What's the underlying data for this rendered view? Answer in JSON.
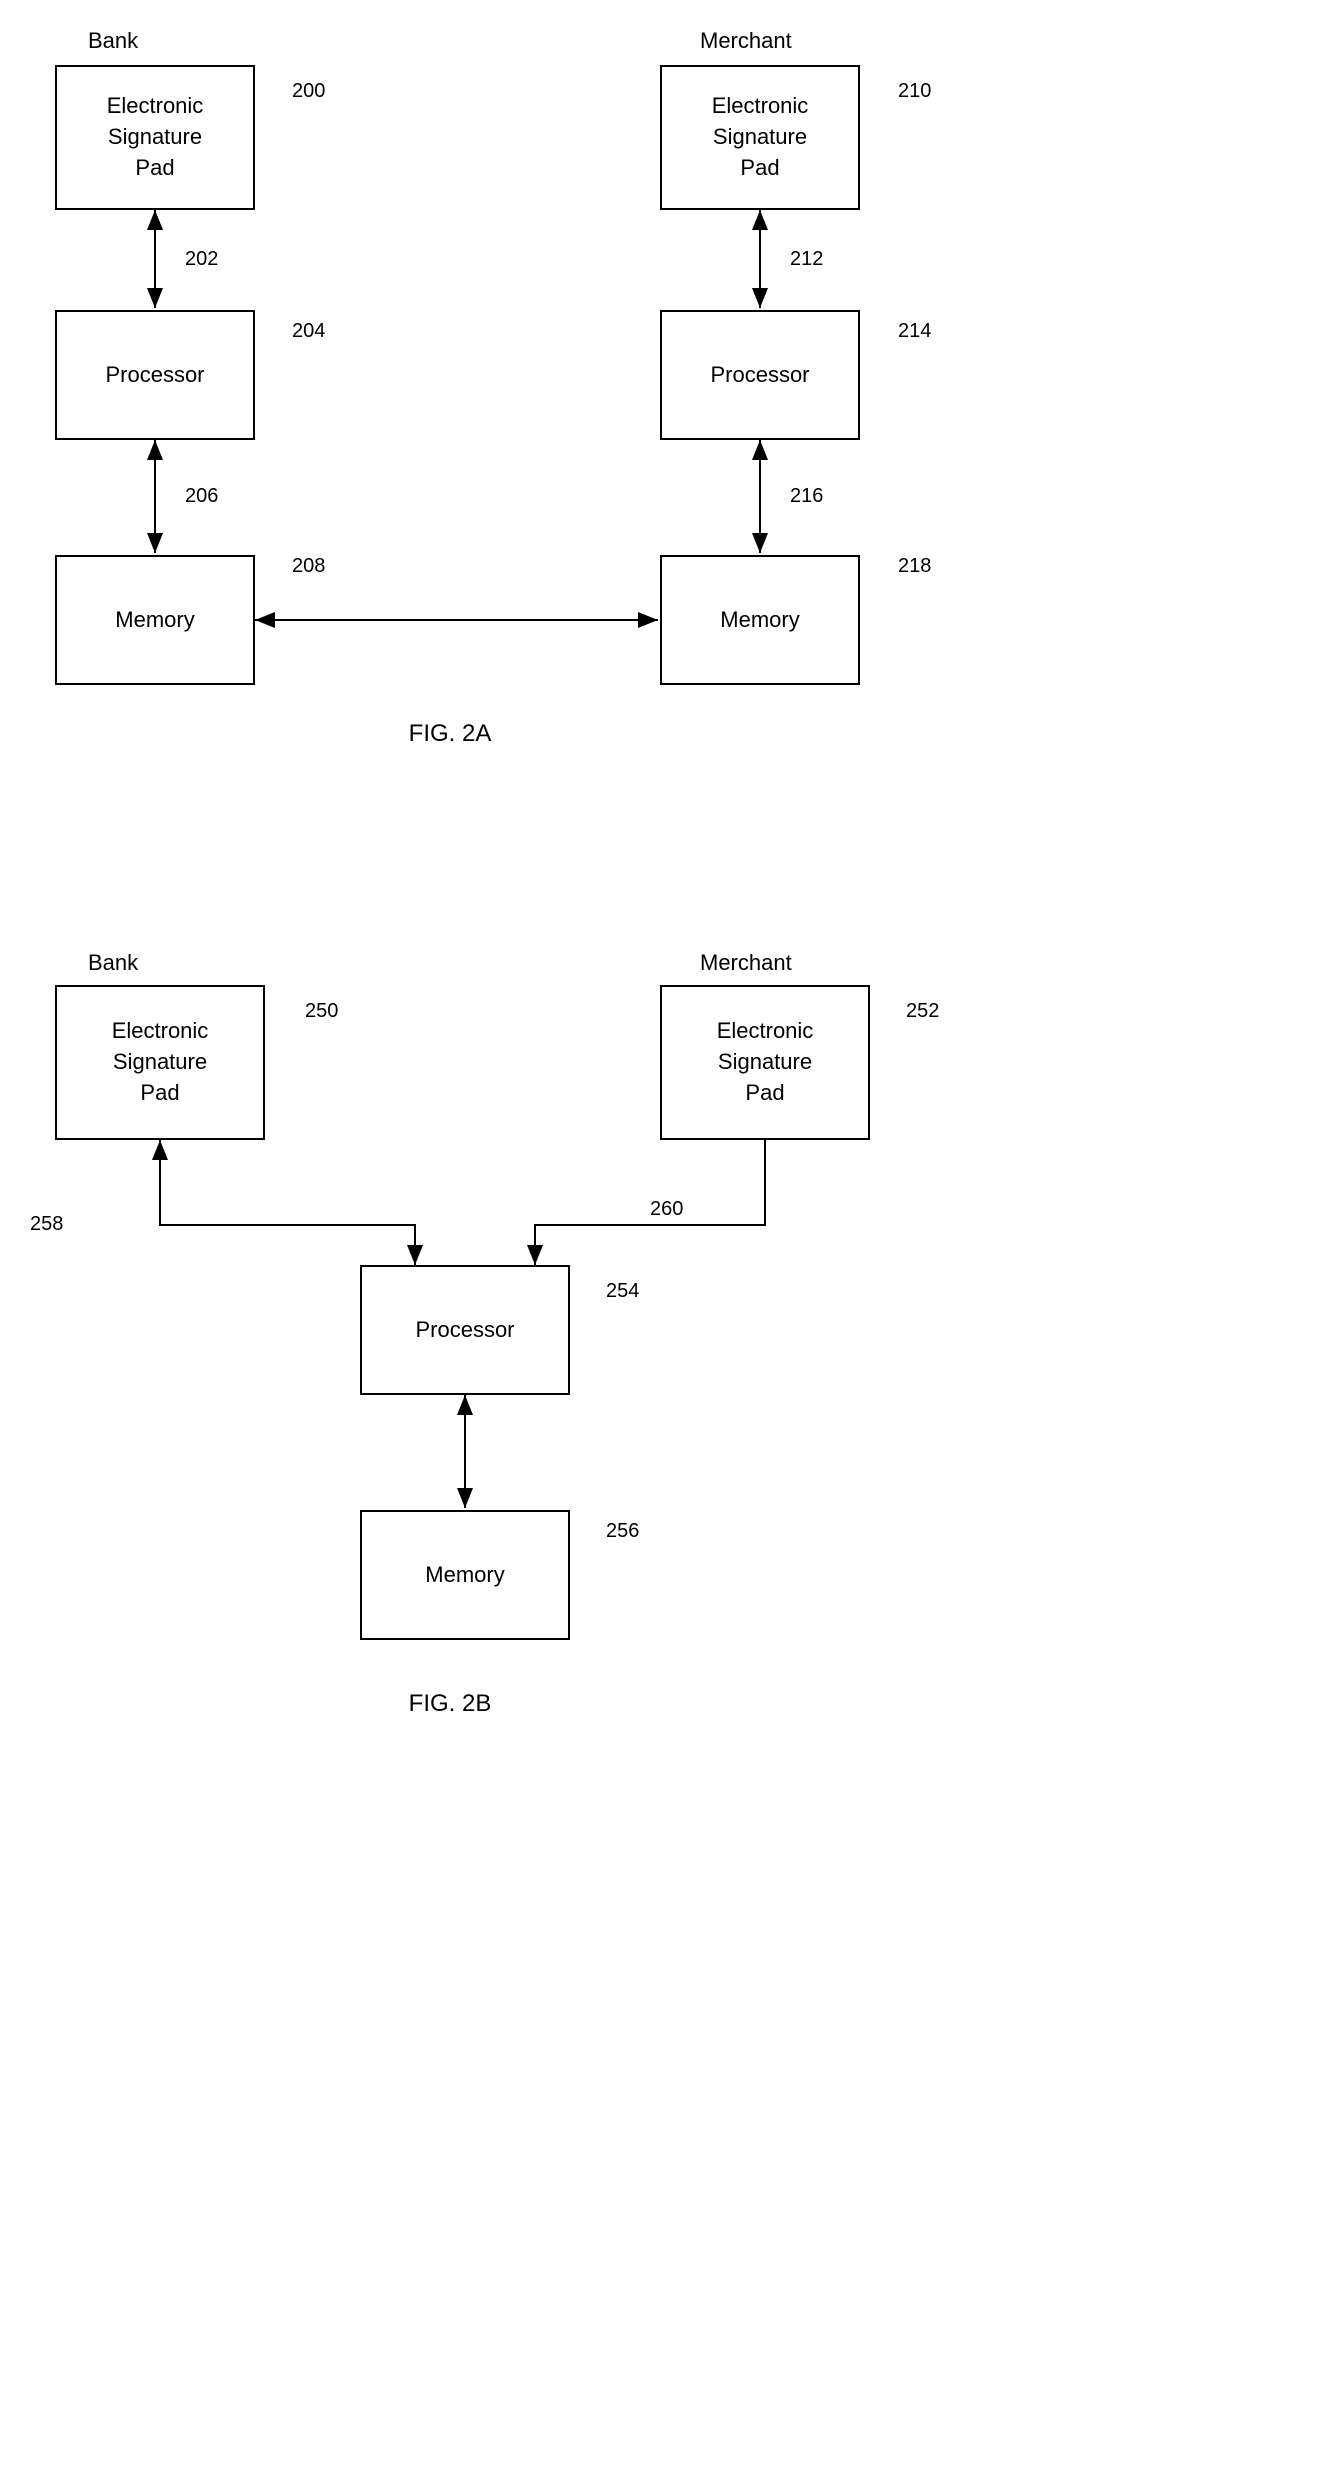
{
  "fig2a": {
    "title": "FIG. 2A",
    "bank_label": "Bank",
    "merchant_label": "Merchant",
    "boxes": {
      "bank_sig": {
        "text": "Electronic\nSignature\nPad",
        "refnum": "200"
      },
      "bank_proc": {
        "text": "Processor",
        "refnum": "204"
      },
      "bank_mem": {
        "text": "Memory",
        "refnum": "208"
      },
      "merch_sig": {
        "text": "Electronic\nSignature\nPad",
        "refnum": "210"
      },
      "merch_proc": {
        "text": "Processor",
        "refnum": "214"
      },
      "merch_mem": {
        "text": "Memory",
        "refnum": "218"
      }
    },
    "arrows": {
      "bank_sig_proc": "202",
      "bank_proc_mem": "206",
      "merch_sig_proc": "212",
      "merch_proc_mem": "216",
      "mem_to_mem": ""
    }
  },
  "fig2b": {
    "title": "FIG. 2B",
    "bank_label": "Bank",
    "merchant_label": "Merchant",
    "boxes": {
      "bank_sig": {
        "text": "Electronic\nSignature\nPad",
        "refnum": "250"
      },
      "merch_sig": {
        "text": "Electronic\nSignature\nPad",
        "refnum": "252"
      },
      "proc": {
        "text": "Processor",
        "refnum": "254"
      },
      "mem": {
        "text": "Memory",
        "refnum": "256"
      }
    },
    "arrows": {
      "bank_sig_proc": "258",
      "merch_sig_proc": "260",
      "proc_mem": ""
    }
  }
}
